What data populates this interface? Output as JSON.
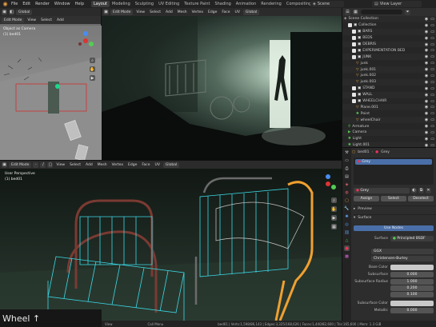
{
  "topbar": {
    "menus": [
      "File",
      "Edit",
      "Render",
      "Window",
      "Help"
    ],
    "workspaces": [
      "Layout",
      "Modeling",
      "Sculpting",
      "UV Editing",
      "Texture Paint",
      "Shading",
      "Animation",
      "Rendering",
      "Compositing"
    ],
    "active_workspace": "Layout",
    "scene": "Scene",
    "view_layer": "View Layer"
  },
  "left_viewport": {
    "mode": "Edit Mode",
    "menus": [
      "View",
      "Select",
      "Add"
    ],
    "overlay_title": "Object as Camera",
    "overlay_sub": "(1) bed01"
  },
  "render_viewport": {
    "mode": "Edit Mode",
    "menus": [
      "View",
      "Select",
      "Add",
      "Mesh",
      "Vertex",
      "Edge",
      "Face",
      "UV"
    ],
    "transform": "Global"
  },
  "bottom_viewport": {
    "mode": "Edit Mode",
    "menus": [
      "View",
      "Select",
      "Add",
      "Mesh",
      "Vertex",
      "Edge",
      "Face",
      "UV"
    ],
    "transform": "Global",
    "overlay_title": "User Perspective",
    "overlay_sub": "(1) bed01"
  },
  "wheel_caption": "Wheel ↑",
  "statusbar": {
    "items": [
      "View",
      "Call Menu",
      "bed01 | Verts:1,598/86,143 | Edges:3,325/168,626 | Faces:1,440/82,600 | Tris:165,600 | Mem: 1.3 GiB"
    ]
  },
  "outliner": {
    "rows": [
      {
        "name": "Scene Collection",
        "kind": "scene",
        "indent": 0
      },
      {
        "name": "Collection",
        "kind": "collection",
        "indent": 1
      },
      {
        "name": "BARS",
        "kind": "collection",
        "indent": 2
      },
      {
        "name": "BEDS",
        "kind": "collection",
        "indent": 2
      },
      {
        "name": "DEBRIS",
        "kind": "collection",
        "indent": 2
      },
      {
        "name": "EXPERIMENTATION BED",
        "kind": "collection",
        "indent": 2
      },
      {
        "name": "JUNK",
        "kind": "collection",
        "indent": 2
      },
      {
        "name": "junk",
        "kind": "object",
        "indent": 3
      },
      {
        "name": "junk.001",
        "kind": "object",
        "indent": 3
      },
      {
        "name": "junk.002",
        "kind": "object",
        "indent": 3
      },
      {
        "name": "junk.003",
        "kind": "object",
        "indent": 3
      },
      {
        "name": "STAND",
        "kind": "collection",
        "indent": 2
      },
      {
        "name": "WALL",
        "kind": "collection",
        "indent": 2
      },
      {
        "name": "WHEELCHAIR",
        "kind": "collection",
        "indent": 2
      },
      {
        "name": "Plane.001",
        "kind": "object",
        "indent": 3
      },
      {
        "name": "Point",
        "kind": "light",
        "indent": 3
      },
      {
        "name": "wheelChair",
        "kind": "object",
        "indent": 3
      },
      {
        "name": "Armature",
        "kind": "armature",
        "indent": 1
      },
      {
        "name": "Camera",
        "kind": "camera",
        "indent": 1
      },
      {
        "name": "Light",
        "kind": "light",
        "indent": 1
      },
      {
        "name": "Light.001",
        "kind": "light",
        "indent": 1
      }
    ]
  },
  "properties": {
    "object_name": "bed01",
    "material_name": "Grey",
    "slot": "Grey",
    "slot_material": "Grey",
    "slot_buttons": [
      "Assign",
      "Select",
      "Deselect"
    ],
    "preview_label": "Preview",
    "surface_label": "Surface",
    "use_nodes_label": "Use Nodes",
    "surface_shader": "Principled BSDF",
    "distribution": "GGX",
    "subsurface_method": "Christensen-Burley",
    "fields": [
      {
        "label": "Base Color",
        "value": ""
      },
      {
        "label": "Subsurface",
        "value": "0.000"
      },
      {
        "label": "Subsurface Radius",
        "value": "1.000"
      },
      {
        "label": "",
        "value": "0.200"
      },
      {
        "label": "",
        "value": "0.100"
      },
      {
        "label": "Subsurface Color",
        "value": ""
      },
      {
        "label": "Metallic",
        "value": "0.000"
      }
    ]
  },
  "colors": {
    "accent": "#4a7ac7",
    "wire": "#3bd9e6",
    "orange": "#f0a030"
  }
}
